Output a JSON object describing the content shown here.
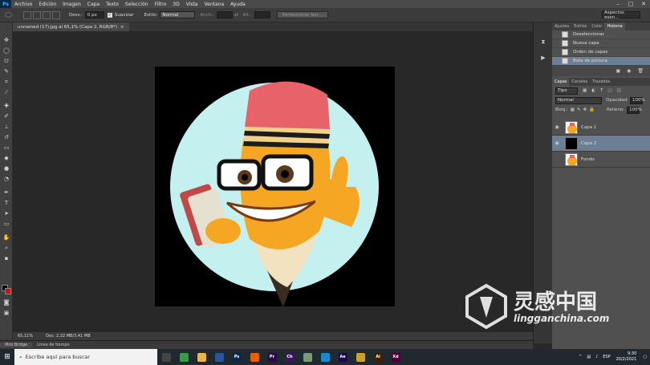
{
  "menubar": {
    "app_icon": "Ps",
    "items": [
      "Archivo",
      "Edición",
      "Imagen",
      "Capa",
      "Texto",
      "Selección",
      "Filtro",
      "3D",
      "Vista",
      "Ventana",
      "Ayuda"
    ]
  },
  "optionsbar": {
    "desv_label": "Desv.:",
    "desv_value": "0 px",
    "suavizar_label": "Suavizar",
    "estilo_label": "Estilo:",
    "estilo_value": "Normal",
    "ancho_label": "Anch.:",
    "alto_label": "Alt.:",
    "refine_button": "Perfeccionar bor...",
    "workspace_value": "Aspectos esen..."
  },
  "document": {
    "tab_title": "unnamed (17).jpg al 65,1% (Capa 2, RGB/8*)",
    "tab_close": "×",
    "zoom": "65,11%",
    "doc_info": "Doc: 2,32 MB/3,41 MB"
  },
  "bottom_tabs": [
    "Mini Bridge",
    "Línea de tiempo"
  ],
  "history_panel": {
    "tabs": [
      "Ajustes",
      "Estilos",
      "Color",
      "Historia"
    ],
    "active_tab": "Historia",
    "items": [
      {
        "label": "Deseleccionar",
        "selected": false
      },
      {
        "label": "Nueva capa",
        "selected": false
      },
      {
        "label": "Orden de capas",
        "selected": false
      },
      {
        "label": "Bote de pintura",
        "selected": true
      }
    ]
  },
  "layers_panel": {
    "tabs": [
      "Capas",
      "Canales",
      "Trazados"
    ],
    "active_tab": "Capas",
    "filter": "Tipo",
    "blend_mode": "Normal",
    "opacity_label": "Opacidad:",
    "opacity_value": "100%",
    "lock_label": "Bloq.:",
    "fill_label": "Relleno:",
    "fill_value": "100%",
    "layers": [
      {
        "name": "Capa 1",
        "thumb": "pencil",
        "visible": true,
        "selected": false
      },
      {
        "name": "Capa 2",
        "thumb": "black",
        "visible": true,
        "selected": true
      },
      {
        "name": "Fondo",
        "thumb": "pencil",
        "visible": false,
        "selected": false
      }
    ]
  },
  "taskbar": {
    "search_placeholder": "Escribe aquí para buscar",
    "apps": [
      {
        "name": "task-view",
        "color": "#444"
      },
      {
        "name": "chrome",
        "color": "#3a9a4a"
      },
      {
        "name": "file-explorer",
        "color": "#e8b54a"
      },
      {
        "name": "word",
        "color": "#2b579a"
      },
      {
        "name": "photoshop",
        "color": "#0a2a4a"
      },
      {
        "name": "firefox",
        "color": "#e66000"
      },
      {
        "name": "premiere",
        "color": "#2a0a4a"
      },
      {
        "name": "character-animator",
        "color": "#3a1a5a"
      },
      {
        "name": "notes",
        "color": "#7a9a7a"
      },
      {
        "name": "edge",
        "color": "#1a8ad0"
      },
      {
        "name": "after-effects",
        "color": "#1a0a4a"
      },
      {
        "name": "cash",
        "color": "#c9a02a"
      },
      {
        "name": "illustrator",
        "color": "#3a2200"
      },
      {
        "name": "xd",
        "color": "#470137"
      }
    ],
    "app_labels": {
      "photoshop": "Ps",
      "premiere": "Pr",
      "character-animator": "Ch",
      "after-effects": "Ae",
      "illustrator": "Ai",
      "xd": "Xd"
    },
    "lang": "ESP",
    "time": "9:30",
    "date": "20/2/2021"
  },
  "watermark": {
    "cn_text": "灵感中国",
    "domain": "lingganchina.com"
  },
  "colors": {
    "accent": "#6d7f95",
    "canvas_circle": "#c4f1ef",
    "pencil_yellow": "#f5a623",
    "eraser": "#e8626a"
  }
}
